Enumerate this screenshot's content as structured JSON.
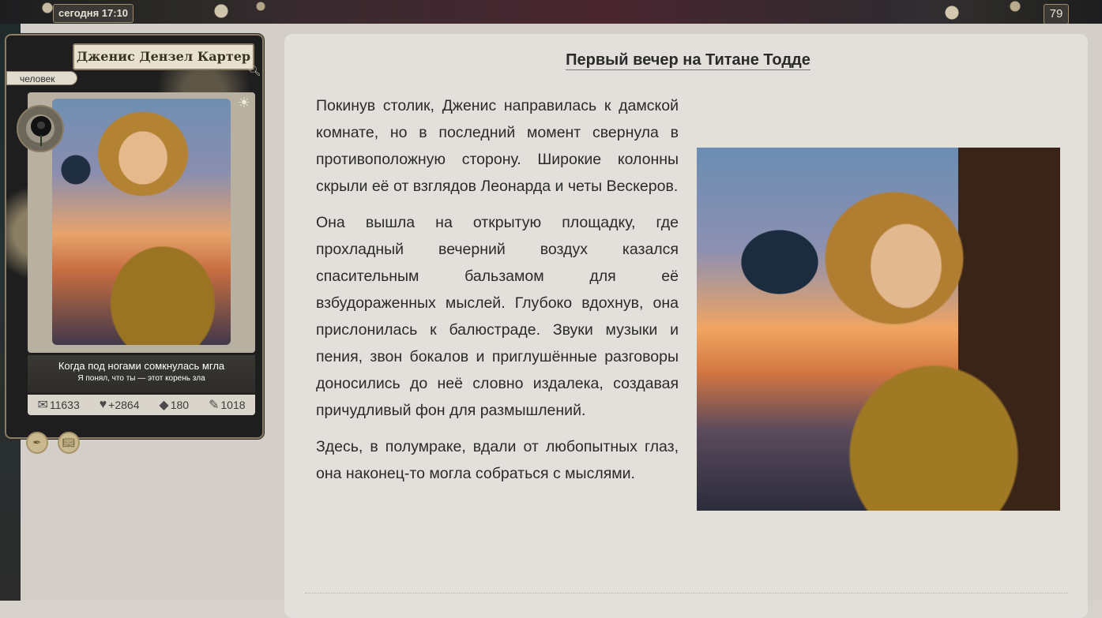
{
  "header": {
    "timestamp": "сегодня 17:10",
    "post_number": "79"
  },
  "profile": {
    "name": "Дженис Дензел Картер",
    "race": "человек",
    "caption_title": "Когда под ногами сомкнулась мгла",
    "caption_subtitle": "Я понял, что ты — этот корень зла",
    "stats": {
      "messages": "11633",
      "reputation": "+2864",
      "gems": "180",
      "posts": "1018"
    }
  },
  "post": {
    "title": "Первый вечер на Титане Тодде",
    "paragraphs": [
      "Покинув столик, Дженис направилась к дамской комнате, но в последний момент свернула в противоположную сторону. Широкие колонны скрыли её от взглядов Леонарда и четы Вескеров.",
      "Она вышла на открытую площадку, где прохладный вечерний воздух казался спасительным бальзамом для её взбудораженных мыслей. Глубоко вдохнув, она прислонилась к балюстраде. Звуки музыки и пения, звон бокалов и приглушённые разговоры доносились до неё словно издалека, создавая причудливый фон для размышлений.",
      "Здесь, в полумраке, вдали от любопытных глаз, она наконец-то могла собраться с мыслями."
    ]
  },
  "icons": {
    "search": "search-icon",
    "sun": "sun-icon",
    "rose": "rose-icon",
    "messages": "envelope-icon",
    "reputation": "heart-icon",
    "gems": "diamond-icon",
    "posts": "pen-icon"
  }
}
